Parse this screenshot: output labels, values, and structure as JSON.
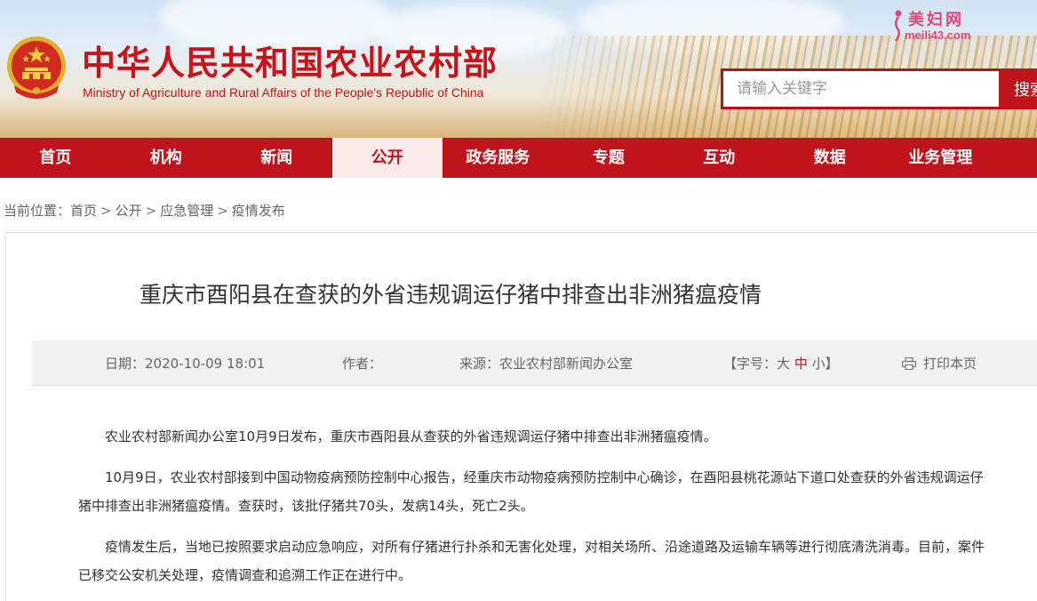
{
  "header": {
    "title": "中华人民共和国农业农村部",
    "subtitle": "Ministry of Agriculture and Rural Affairs of the People's Republic of China",
    "watermark_brand": "美妇网",
    "watermark_url": "meili43.com"
  },
  "search": {
    "placeholder": "请输入关键字",
    "button_label": "搜索"
  },
  "nav": {
    "items": [
      "首页",
      "机构",
      "新闻",
      "公开",
      "政务服务",
      "专题",
      "互动",
      "数据",
      "业务管理"
    ],
    "active": "公开"
  },
  "breadcrumb": {
    "prefix": "当前位置：",
    "items": [
      "首页",
      "公开",
      "应急管理",
      "疫情发布"
    ],
    "separator": ">"
  },
  "article": {
    "title": "重庆市酉阳县在查获的外省违规调运仔猪中排查出非洲猪瘟疫情",
    "meta": {
      "date": "日期：2020-10-09 18:01",
      "author": "作者：",
      "source": "来源：农业农村部新闻办公室",
      "fontsize_prefix": "【字号：",
      "fontsize_large": "大",
      "fontsize_medium": "中",
      "fontsize_small": "小",
      "fontsize_suffix": "】",
      "print_label": "打印本页"
    },
    "paragraphs": [
      "农业农村部新闻办公室10月9日发布，重庆市酉阳县从查获的外省违规调运仔猪中排查出非洲猪瘟疫情。",
      "10月9日，农业农村部接到中国动物疫病预防控制中心报告，经重庆市动物疫病预防控制中心确诊，在酉阳县桃花源站下道口处查获的外省违规调运仔猪中排查出非洲猪瘟疫情。查获时，该批仔猪共70头，发病14头，死亡2头。",
      "疫情发生后，当地已按照要求启动应急响应，对所有仔猪进行扑杀和无害化处理，对相关场所、沿途道路及运输车辆等进行彻底清洗消毒。目前，案件已移交公安机关处理，疫情调查和追溯工作正在进行中。"
    ]
  },
  "colors": {
    "brand_red": "#c0141c",
    "nav_active_bg": "#fbeaea",
    "meta_bar_bg": "#f1f1f1"
  },
  "icons": [
    "national-emblem-icon",
    "print-icon"
  ]
}
